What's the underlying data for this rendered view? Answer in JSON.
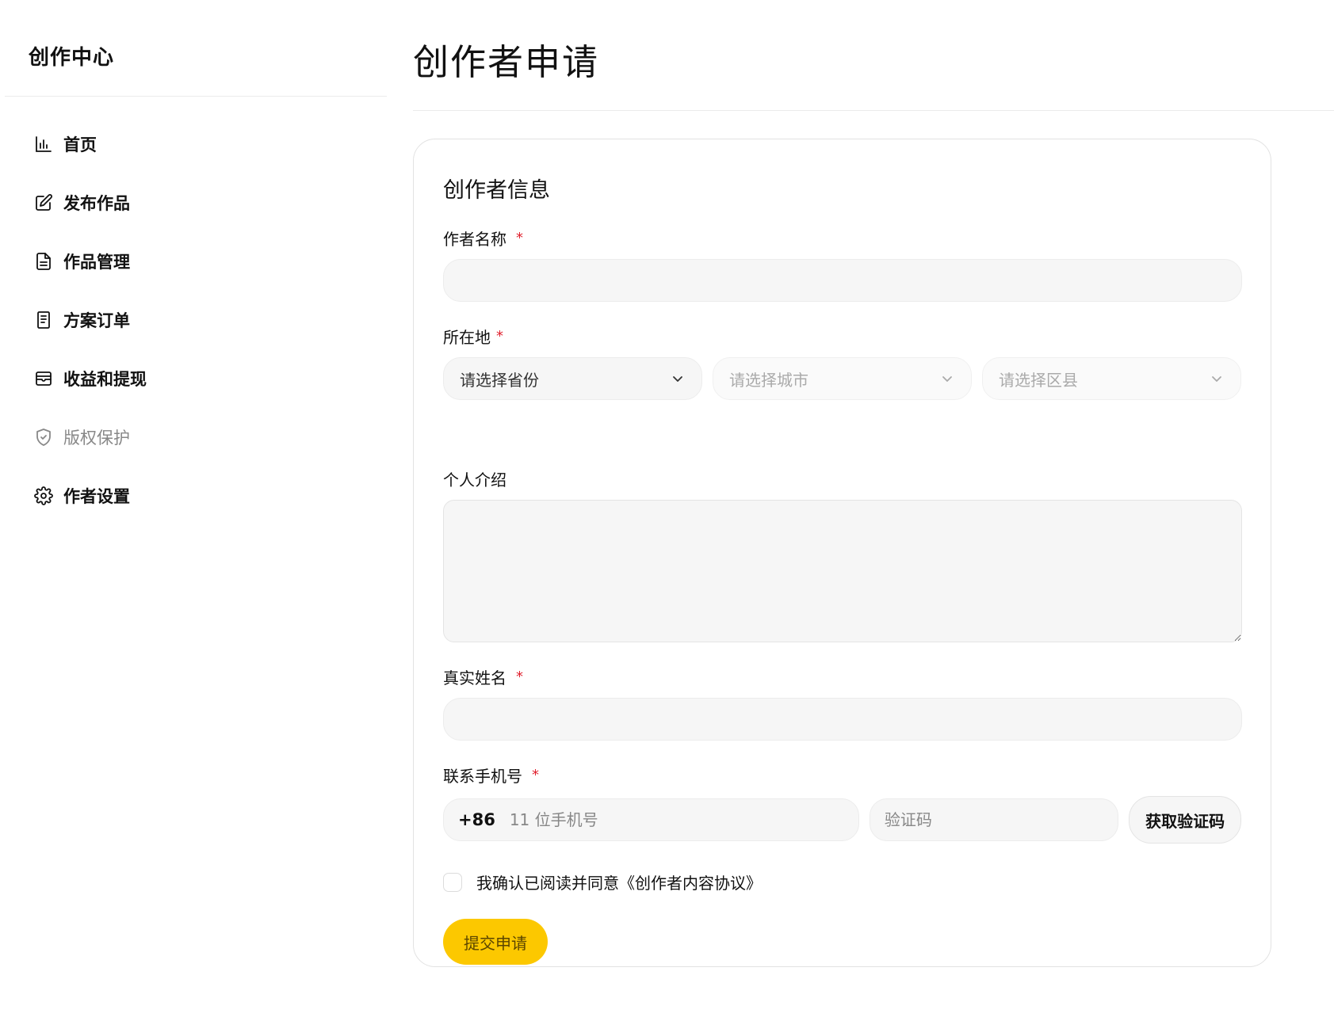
{
  "sidebar": {
    "brand": "创作中心",
    "items": [
      {
        "label": "首页",
        "icon": "bar-chart-icon"
      },
      {
        "label": "发布作品",
        "icon": "edit-icon"
      },
      {
        "label": "作品管理",
        "icon": "document-icon"
      },
      {
        "label": "方案订单",
        "icon": "receipt-icon"
      },
      {
        "label": "收益和提现",
        "icon": "wallet-icon"
      },
      {
        "label": "版权保护",
        "icon": "shield-check-icon",
        "muted": true
      },
      {
        "label": "作者设置",
        "icon": "gear-icon"
      }
    ]
  },
  "page": {
    "title": "创作者申请"
  },
  "form": {
    "section_title": "创作者信息",
    "author_name": {
      "label": "作者名称",
      "required_mark": "*",
      "value": ""
    },
    "location": {
      "label": "所在地",
      "required_mark": "*",
      "province_placeholder": "请选择省份",
      "city_placeholder": "请选择城市",
      "district_placeholder": "请选择区县"
    },
    "bio": {
      "label": "个人介绍",
      "value": ""
    },
    "real_name": {
      "label": "真实姓名",
      "required_mark": "*",
      "value": ""
    },
    "phone": {
      "label": "联系手机号",
      "required_mark": "*",
      "prefix": "+86",
      "placeholder": "11 位手机号",
      "code_placeholder": "验证码",
      "get_code_label": "获取验证码"
    },
    "agreement": {
      "text": "我确认已阅读并同意《创作者内容协议》",
      "checked": false
    },
    "submit_label": "提交申请"
  },
  "colors": {
    "accent": "#fcc800",
    "required": "#e0202e",
    "input_bg": "#f6f6f6"
  }
}
